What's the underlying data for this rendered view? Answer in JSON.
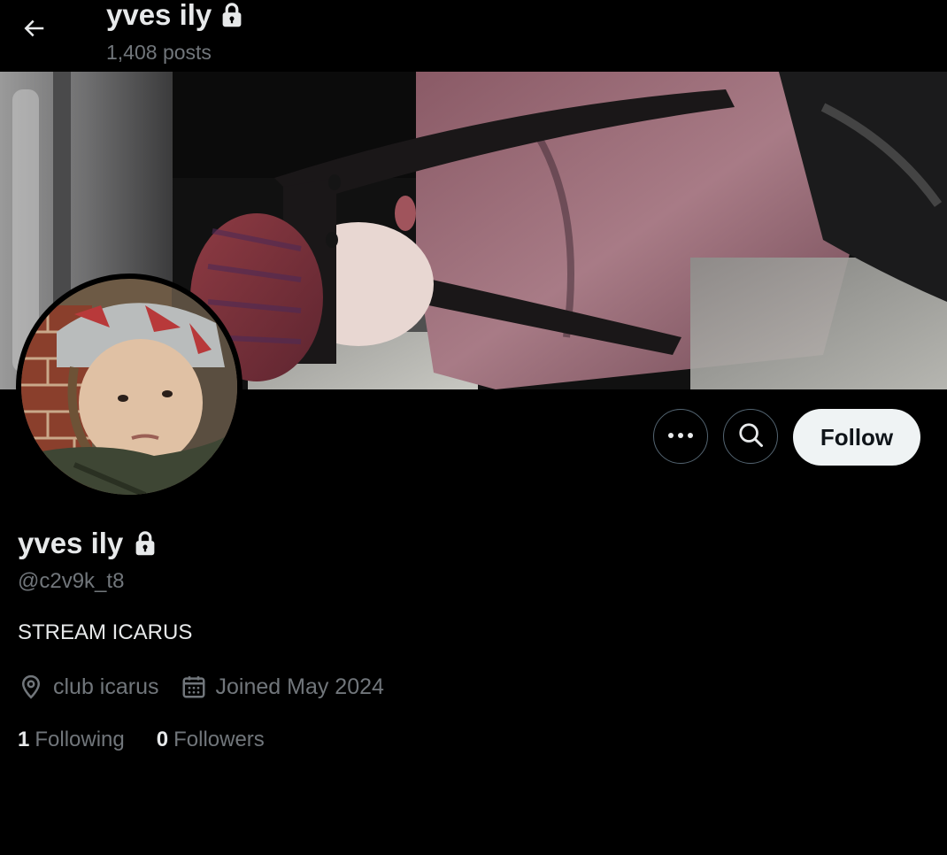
{
  "header": {
    "name": "yves ily",
    "posts_count": "1,408 posts",
    "back_icon": "arrow-left-icon",
    "lock_icon": "lock-icon"
  },
  "profile": {
    "name": "yves ily",
    "handle": "@c2v9k_t8",
    "bio": "STREAM ICARUS",
    "location": "club icarus",
    "joined": "Joined May 2024",
    "following_count": "1",
    "following_label": "Following",
    "followers_count": "0",
    "followers_label": "Followers"
  },
  "actions": {
    "follow_label": "Follow",
    "more_icon": "more-dots-icon",
    "search_icon": "search-icon"
  },
  "colors": {
    "background": "#000000",
    "primary_text": "#e7e9ea",
    "secondary_text": "#71767b",
    "follow_button_bg": "#eff3f4",
    "border": "#536471"
  }
}
